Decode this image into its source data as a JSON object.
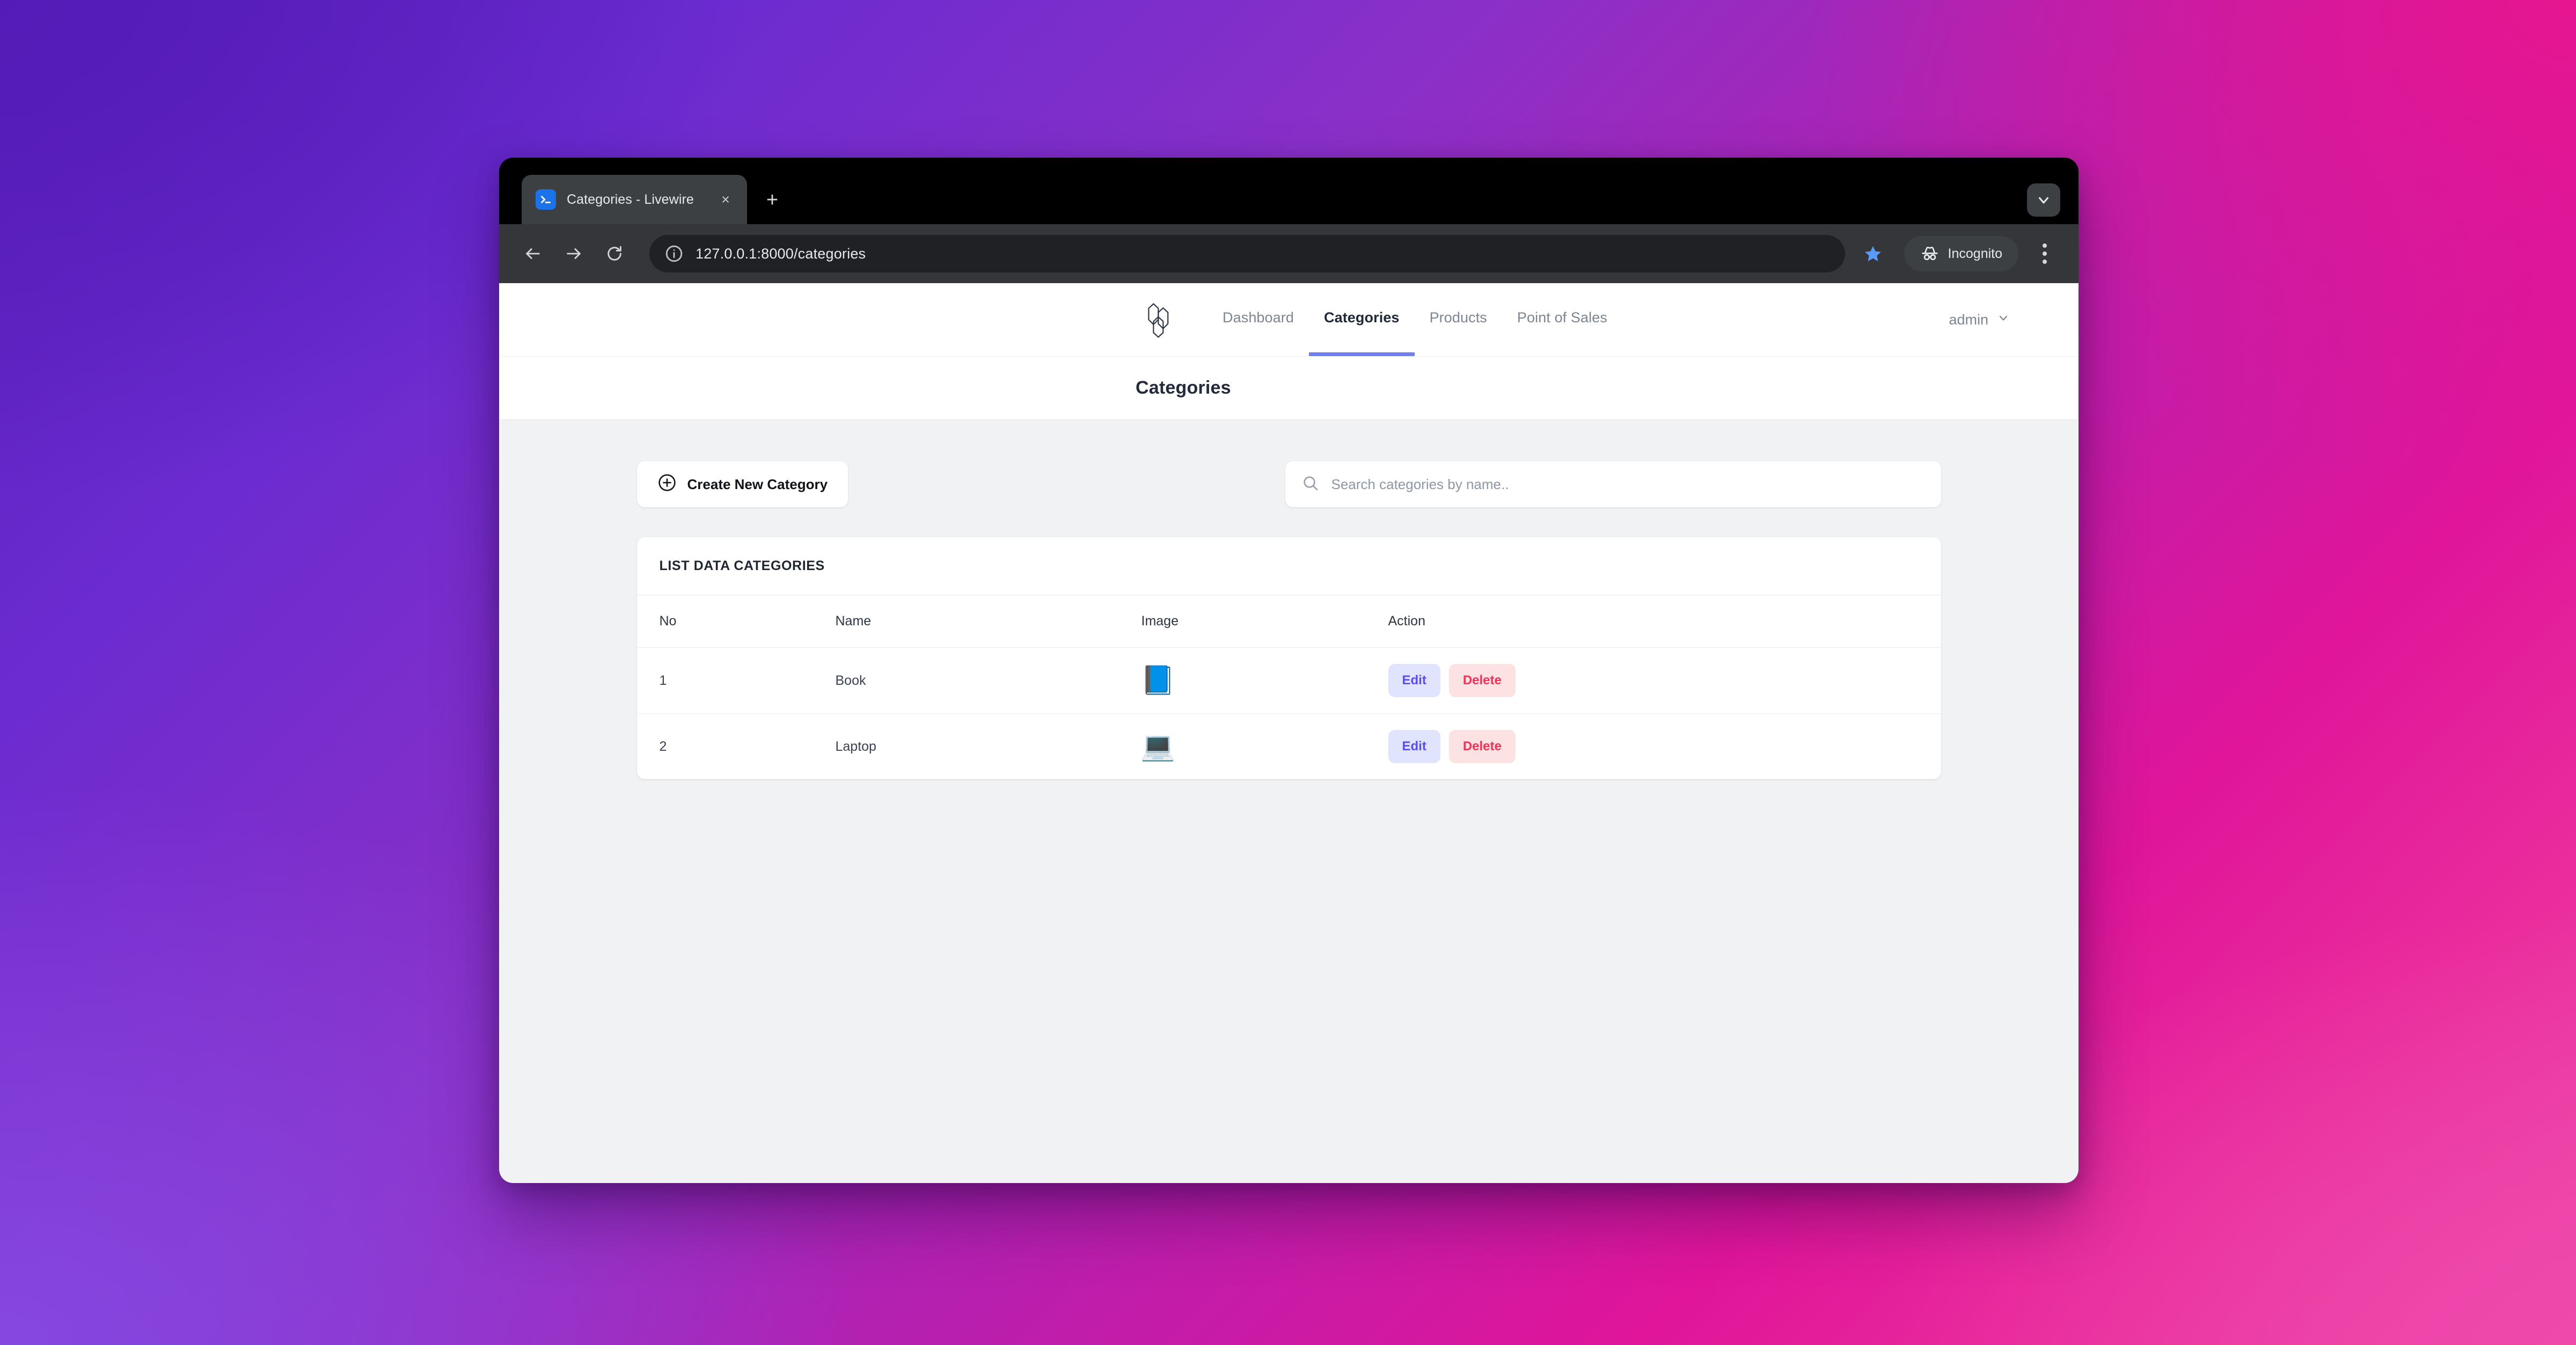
{
  "browser": {
    "tab": {
      "title": "Categories - Livewire",
      "favicon_name": "terminal-favicon",
      "close_label": "×"
    },
    "new_tab_label": "+",
    "toolbar": {
      "back_label": "Back",
      "forward_label": "Forward",
      "reload_label": "Reload",
      "url": "127.0.0.1:8000/categories",
      "site_info_name": "site-info-icon",
      "bookmark_name": "bookmark-star-icon",
      "bookmark_color": "#5b9bf8",
      "incognito_label": "Incognito",
      "menu_label": "Customize and control"
    },
    "tabstrip_menu_label": "Search tabs"
  },
  "app": {
    "brand_name": "laravel-logo",
    "nav_items": [
      {
        "label": "Dashboard",
        "active": false
      },
      {
        "label": "Categories",
        "active": true
      },
      {
        "label": "Products",
        "active": false
      },
      {
        "label": "Point of Sales",
        "active": false
      }
    ],
    "user": {
      "name": "admin"
    },
    "accent_color": "#6f7ef0"
  },
  "page": {
    "title": "Categories"
  },
  "toolbar": {
    "create_label": "Create New Category",
    "create_icon": "plus-circle-icon"
  },
  "search": {
    "placeholder": "Search categories by name..",
    "value": "",
    "icon": "search-icon"
  },
  "card": {
    "heading": "LIST DATA CATEGORIES",
    "columns": [
      "No",
      "Name",
      "Image",
      "Action"
    ],
    "rows": [
      {
        "no": "1",
        "name": "Book",
        "image_glyph": "📘",
        "image_name": "book-image",
        "edit_label": "Edit",
        "delete_label": "Delete"
      },
      {
        "no": "2",
        "name": "Laptop",
        "image_glyph": "💻",
        "image_name": "laptop-image",
        "edit_label": "Edit",
        "delete_label": "Delete"
      }
    ],
    "edit_color": "#5b4df5",
    "delete_color": "#f43257"
  }
}
